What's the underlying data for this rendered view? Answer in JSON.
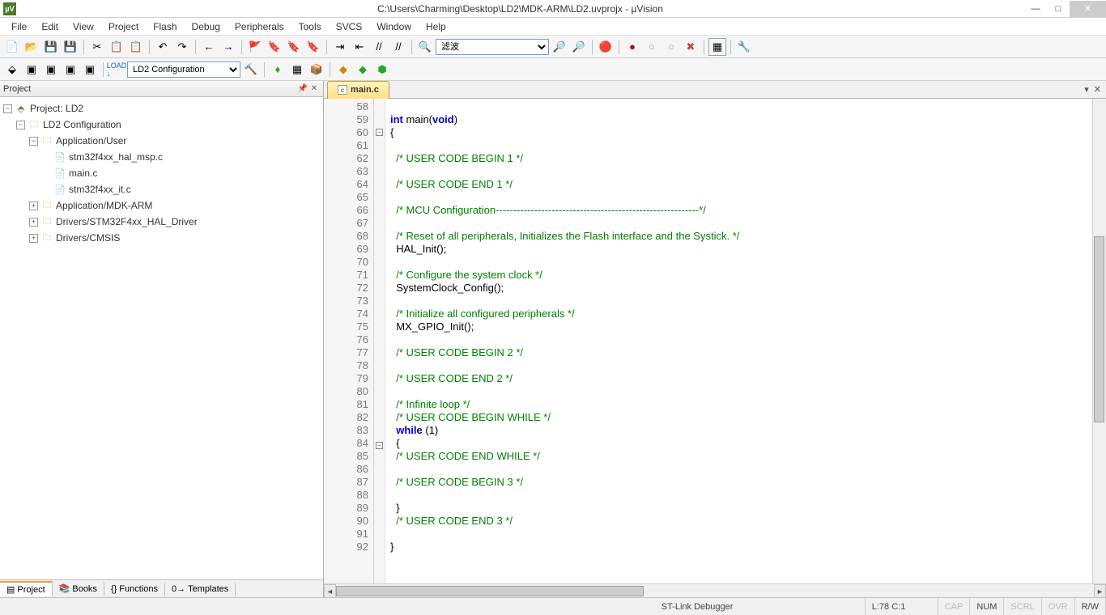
{
  "title": "C:\\Users\\Charming\\Desktop\\LD2\\MDK-ARM\\LD2.uvprojx - µVision",
  "menu": [
    "File",
    "Edit",
    "View",
    "Project",
    "Flash",
    "Debug",
    "Peripherals",
    "Tools",
    "SVCS",
    "Window",
    "Help"
  ],
  "toolbar1": {
    "filter_label": "滤波"
  },
  "toolbar2": {
    "target": "LD2 Configuration"
  },
  "project_panel": {
    "title": "Project",
    "root": "Project: LD2",
    "config": "LD2 Configuration",
    "app_user": "Application/User",
    "files": [
      "stm32f4xx_hal_msp.c",
      "main.c",
      "stm32f4xx_it.c"
    ],
    "app_mdk": "Application/MDK-ARM",
    "drv_hal": "Drivers/STM32F4xx_HAL_Driver",
    "drv_cmsis": "Drivers/CMSIS",
    "tabs": [
      "Project",
      "Books",
      "Functions",
      "Templates"
    ]
  },
  "editor": {
    "tab": "main.c",
    "lines": [
      {
        "n": 58,
        "t": ""
      },
      {
        "n": 59,
        "t": "int main(void)",
        "kind": "sig"
      },
      {
        "n": 60,
        "t": "{",
        "fold": "-"
      },
      {
        "n": 61,
        "t": ""
      },
      {
        "n": 62,
        "t": "  /* USER CODE BEGIN 1 */",
        "kind": "cm"
      },
      {
        "n": 63,
        "t": ""
      },
      {
        "n": 64,
        "t": "  /* USER CODE END 1 */",
        "kind": "cm"
      },
      {
        "n": 65,
        "t": ""
      },
      {
        "n": 66,
        "t": "  /* MCU Configuration----------------------------------------------------------*/",
        "kind": "cm"
      },
      {
        "n": 67,
        "t": ""
      },
      {
        "n": 68,
        "t": "  /* Reset of all peripherals, Initializes the Flash interface and the Systick. */",
        "kind": "cm"
      },
      {
        "n": 69,
        "t": "  HAL_Init();"
      },
      {
        "n": 70,
        "t": ""
      },
      {
        "n": 71,
        "t": "  /* Configure the system clock */",
        "kind": "cm"
      },
      {
        "n": 72,
        "t": "  SystemClock_Config();"
      },
      {
        "n": 73,
        "t": ""
      },
      {
        "n": 74,
        "t": "  /* Initialize all configured peripherals */",
        "kind": "cm"
      },
      {
        "n": 75,
        "t": "  MX_GPIO_Init();"
      },
      {
        "n": 76,
        "t": ""
      },
      {
        "n": 77,
        "t": "  /* USER CODE BEGIN 2 */",
        "kind": "cm"
      },
      {
        "n": 78,
        "t": ""
      },
      {
        "n": 79,
        "t": "  /* USER CODE END 2 */",
        "kind": "cm"
      },
      {
        "n": 80,
        "t": ""
      },
      {
        "n": 81,
        "t": "  /* Infinite loop */",
        "kind": "cm"
      },
      {
        "n": 82,
        "t": "  /* USER CODE BEGIN WHILE */",
        "kind": "cm"
      },
      {
        "n": 83,
        "t": "  while (1)",
        "kind": "while"
      },
      {
        "n": 84,
        "t": "  {",
        "fold": "-"
      },
      {
        "n": 85,
        "t": "  /* USER CODE END WHILE */",
        "kind": "cm"
      },
      {
        "n": 86,
        "t": ""
      },
      {
        "n": 87,
        "t": "  /* USER CODE BEGIN 3 */",
        "kind": "cm"
      },
      {
        "n": 88,
        "t": ""
      },
      {
        "n": 89,
        "t": "  }"
      },
      {
        "n": 90,
        "t": "  /* USER CODE END 3 */",
        "kind": "cm"
      },
      {
        "n": 91,
        "t": ""
      },
      {
        "n": 92,
        "t": "}"
      }
    ]
  },
  "status": {
    "debugger": "ST-Link Debugger",
    "pos": "L:78 C:1",
    "caps": "CAP",
    "num": "NUM",
    "scrl": "SCRL",
    "ovr": "OVR",
    "rw": "R/W"
  }
}
